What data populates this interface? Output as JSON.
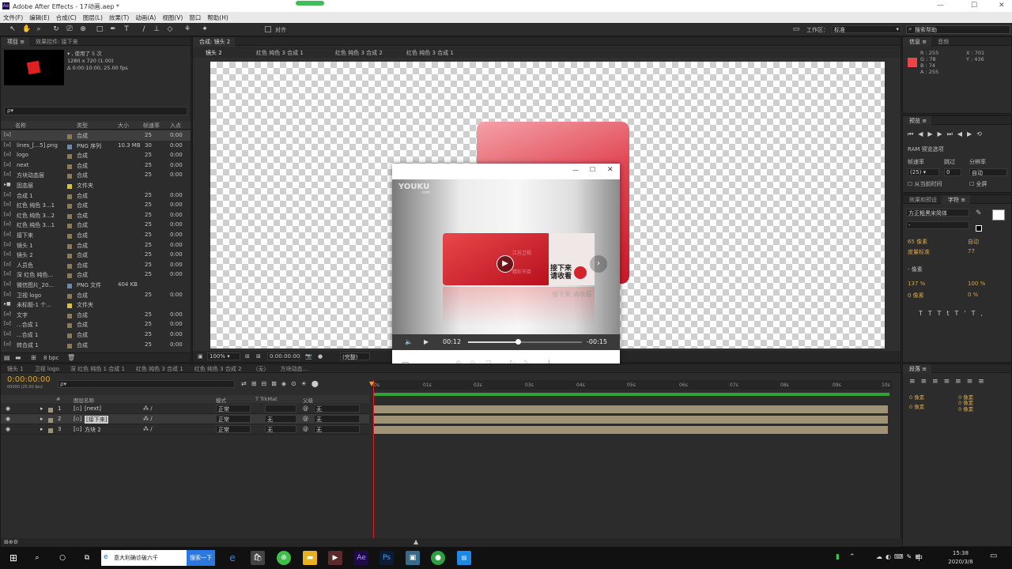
{
  "window": {
    "title": "Adobe After Effects - 17动画.aep *",
    "min": "—",
    "max": "☐",
    "close": "✕"
  },
  "menu": [
    "文件(F)",
    "编辑(E)",
    "合成(C)",
    "图层(L)",
    "效果(T)",
    "动画(A)",
    "视图(V)",
    "窗口",
    "帮助(H)"
  ],
  "toolbar": {
    "snap_label": "对齐",
    "workspace_label": "工作区：",
    "workspace_value": "标准",
    "search_placeholder": "搜索帮助"
  },
  "project": {
    "tabs": [
      "项目 ≡",
      "效果控件: 接下来"
    ],
    "info_lines": [
      "▾ , 使用了 5 次",
      "1280 x 720 (1.00)",
      "Δ 0:00:10:00, 25.00 fps"
    ],
    "search_placeholder": "ρ▾",
    "headers": {
      "name": "名称",
      "type": "类型",
      "size": "大小",
      "fps": "帧速率",
      "in": "入点"
    },
    "items": [
      {
        "name": "",
        "type": "合成",
        "size": "",
        "fps": "25",
        "in": "0:00",
        "color": "#8a7a5a"
      },
      {
        "name": "lines_[...5].png",
        "type": "PNG 序列",
        "size": "10.3 MB",
        "fps": "30",
        "in": "0:00",
        "color": "#6f86a8"
      },
      {
        "name": "logo",
        "type": "合成",
        "size": "",
        "fps": "25",
        "in": "0:00",
        "color": "#8a7a5a"
      },
      {
        "name": "next",
        "type": "合成",
        "size": "",
        "fps": "25",
        "in": "0:00",
        "color": "#8a7a5a"
      },
      {
        "name": "方块动态层",
        "type": "合成",
        "size": "",
        "fps": "25",
        "in": "0:00",
        "color": "#8a7a5a"
      },
      {
        "name": "固态层",
        "type": "文件夹",
        "size": "",
        "fps": "",
        "in": "",
        "color": "#d8c43a"
      },
      {
        "name": "合成 1",
        "type": "合成",
        "size": "",
        "fps": "25",
        "in": "0:00",
        "color": "#8a7a5a"
      },
      {
        "name": "红色 纯色 3...1",
        "type": "合成",
        "size": "",
        "fps": "25",
        "in": "0:00",
        "color": "#8a7a5a"
      },
      {
        "name": "红色 纯色 3...2",
        "type": "合成",
        "size": "",
        "fps": "25",
        "in": "0:00",
        "color": "#8a7a5a"
      },
      {
        "name": "红色 纯色 3...1",
        "type": "合成",
        "size": "",
        "fps": "25",
        "in": "0:00",
        "color": "#8a7a5a"
      },
      {
        "name": "接下来",
        "type": "合成",
        "size": "",
        "fps": "25",
        "in": "0:00",
        "color": "#8a7a5a"
      },
      {
        "name": "镜头 1",
        "type": "合成",
        "size": "",
        "fps": "25",
        "in": "0:00",
        "color": "#8a7a5a"
      },
      {
        "name": "镜头 2",
        "type": "合成",
        "size": "",
        "fps": "25",
        "in": "0:00",
        "color": "#8a7a5a"
      },
      {
        "name": "人员色",
        "type": "合成",
        "size": "",
        "fps": "25",
        "in": "0:00",
        "color": "#8a7a5a"
      },
      {
        "name": "深 红色 纯色...",
        "type": "合成",
        "size": "",
        "fps": "25",
        "in": "0:00",
        "color": "#8a7a5a"
      },
      {
        "name": "微信图片_20...",
        "type": "PNG 文件",
        "size": "404 KB",
        "fps": "",
        "in": "",
        "color": "#6f86a8"
      },
      {
        "name": "卫视 logo",
        "type": "合成",
        "size": "",
        "fps": "25",
        "in": "0:00",
        "color": "#8a7a5a"
      },
      {
        "name": "未标题-1 个...",
        "type": "文件夹",
        "size": "",
        "fps": "",
        "in": "",
        "color": "#d8c43a"
      },
      {
        "name": "文字",
        "type": "合成",
        "size": "",
        "fps": "25",
        "in": "0:00",
        "color": "#8a7a5a"
      },
      {
        "name": "...合成 1",
        "type": "合成",
        "size": "",
        "fps": "25",
        "in": "0:00",
        "color": "#8a7a5a"
      },
      {
        "name": "...合成 1",
        "type": "合成",
        "size": "",
        "fps": "25",
        "in": "0:00",
        "color": "#8a7a5a"
      },
      {
        "name": "转合成 1",
        "type": "合成",
        "size": "",
        "fps": "25",
        "in": "0:00",
        "color": "#8a7a5a"
      }
    ],
    "footer_bpc": "8 bpc"
  },
  "composition": {
    "tab": "合成: 镜头 2",
    "breadcrumbs": [
      "镜头 2",
      "红色 纯色 3 合成 1",
      "红色 纯色 3 合成 2",
      "红色 纯色 3 合成 1"
    ],
    "zoom": "100%",
    "timecode": "0:00:00:00",
    "quality": "(完整)"
  },
  "player": {
    "brand": "YOUKU",
    "brand_sub": ".com",
    "time_current": "00:12",
    "time_remaining": "-00:15",
    "progress": 0.44,
    "banner_line1": "接下来",
    "banner_line2": "请收看",
    "banner_small": "江苏卫视",
    "banner_small2": "精彩节目",
    "reflection_text": "接下来 请收看"
  },
  "info_panel": {
    "tabs": [
      "信息 ≡",
      "音频"
    ],
    "r": "R : 255",
    "g": "G : 78",
    "b": "B : 74",
    "a": "A : 255",
    "x": "X : 701",
    "y": "Y : 436",
    "swatch": "#e8474a"
  },
  "preview_panel": {
    "tab": "预览 ≡",
    "ram_label": "RAM 预览选项",
    "fps_label": "帧速率",
    "skip_label": "跳过",
    "res_label": "分辨率",
    "fps_value": "(25)",
    "skip_value": "0",
    "res_value": "自动",
    "from_current": "从当前时间",
    "fullscreen": "全屏"
  },
  "char_panel": {
    "tabs": [
      "效果和预设",
      "字符 ≡"
    ],
    "font": "方正粗黑宋简体",
    "style": "-",
    "size": "65 像素",
    "leading": "自动",
    "kerning": "度量标准",
    "tracking": "77",
    "stroke": "- 像素",
    "vscale": "137 %",
    "hscale": "100 %",
    "baseline": "0 像素",
    "tsume": "0 %"
  },
  "para_panel": {
    "tab": "段落 ≡",
    "v1": "0 像素",
    "v2": "0 像素",
    "v3": "0 像素",
    "v4": "0 像素",
    "v5": "0 像素"
  },
  "timeline": {
    "tabs": [
      "镜头 1",
      "卫视 logo",
      "深 红色 纯色 1 合成 1",
      "红色 纯色 3 合成 1",
      "红色 纯色 3 合成 2",
      "（无）",
      "方块动态..."
    ],
    "timecode": "0:00:00:00",
    "fps": "00000 (25.00 fps)",
    "headers": {
      "num": "#",
      "name": "图层名称",
      "mode": "模式",
      "trkmat": "T TrkMat",
      "parent": "父级"
    },
    "layers": [
      {
        "num": "1",
        "name": "[next]",
        "mode": "正常",
        "trk": "",
        "parent": "无"
      },
      {
        "num": "2",
        "name": "[接下来]",
        "mode": "正常",
        "trk": "无",
        "parent": "无"
      },
      {
        "num": "3",
        "name": "方块 2",
        "mode": "正常",
        "trk": "无",
        "parent": "无"
      }
    ],
    "ruler": [
      "0s",
      "01s",
      "02s",
      "03s",
      "04s",
      "05s",
      "06s",
      "07s",
      "08s",
      "09s",
      "10s"
    ]
  },
  "taskbar": {
    "search_text": "意大利确诊破六千",
    "search_button": "搜索一下",
    "time": "15:38",
    "date": "2020/3/8",
    "ime": "中"
  }
}
